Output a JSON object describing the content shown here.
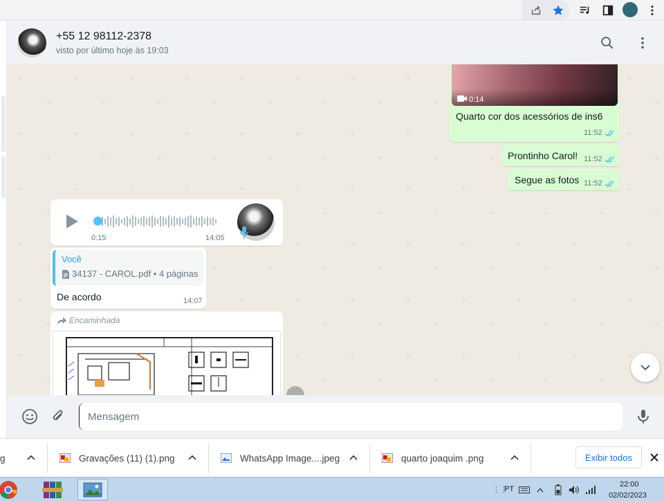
{
  "header": {
    "contact_name": "+55 12 98112-2378",
    "contact_status": "visto por último hoje às 19:03"
  },
  "messages": {
    "video_caption": {
      "duration": "0:14",
      "text": "Quarto cor dos acessórios de ins6",
      "time": "11:52"
    },
    "out_1": {
      "text": "Prontinho Carol!",
      "time": "11:52"
    },
    "out_2": {
      "text": "Segue as fotos",
      "time": "11:52"
    },
    "audio": {
      "elapsed": "0:15",
      "time": "14:05"
    },
    "reply": {
      "quote_author": "Você",
      "quote_doc": "34137 - CAROL.pdf • 4 páginas",
      "text": "De acordo",
      "time": "14:07"
    },
    "forwarded": {
      "label": "Encaminhada"
    }
  },
  "compose": {
    "placeholder": "Mensagem"
  },
  "downloads": {
    "items": [
      {
        "name": "g"
      },
      {
        "name": "Gravações (11) (1).png"
      },
      {
        "name": "WhatsApp Image....jpeg"
      },
      {
        "name": "quarto joaquim .png"
      }
    ],
    "show_all_label": "Exibir todos"
  },
  "taskbar": {
    "language": "PT",
    "time": "22:00",
    "date": "02/02/2023"
  },
  "colors": {
    "outgoing_bubble": "#d9fdd3",
    "incoming_bubble": "#ffffff",
    "chat_background": "#efeae2",
    "read_ticks": "#53bdeb"
  }
}
